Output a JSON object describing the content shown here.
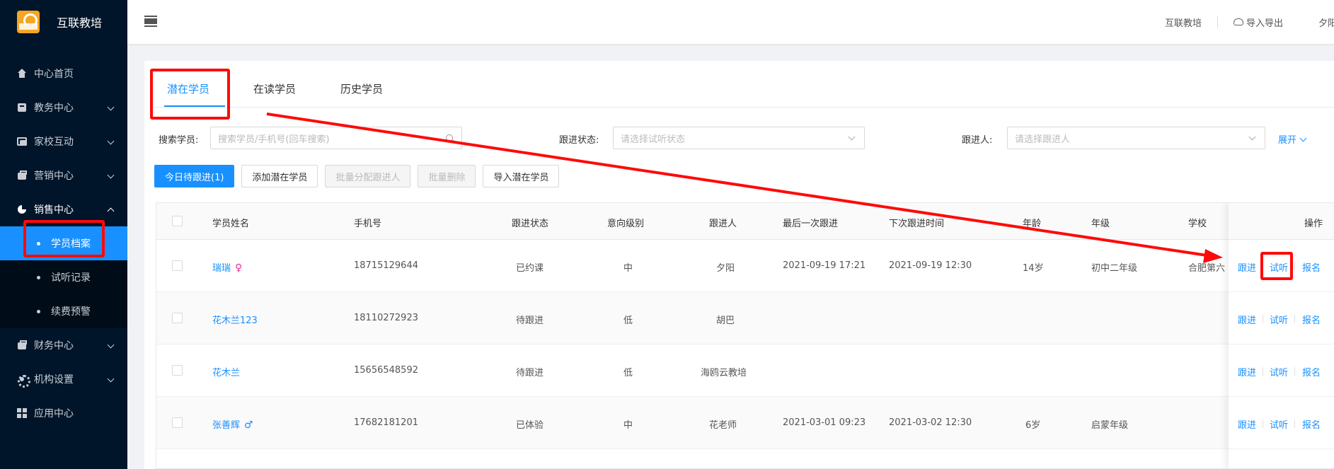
{
  "app": {
    "brand_name": "互联教培"
  },
  "sidebar": {
    "items": [
      {
        "label": "中心首页"
      },
      {
        "label": "教务中心"
      },
      {
        "label": "家校互动"
      },
      {
        "label": "营销中心"
      },
      {
        "label": "销售中心"
      },
      {
        "label": "财务中心"
      },
      {
        "label": "机构设置"
      },
      {
        "label": "应用中心"
      }
    ],
    "sales_sub": [
      {
        "label": "学员档案"
      },
      {
        "label": "试听记录"
      },
      {
        "label": "续费预警"
      }
    ]
  },
  "header": {
    "org": "互联教培",
    "import_export": "导入导出",
    "user": "夕阳"
  },
  "tabs": [
    {
      "label": "潜在学员"
    },
    {
      "label": "在读学员"
    },
    {
      "label": "历史学员"
    }
  ],
  "filters": {
    "search_label": "搜索学员:",
    "search_placeholder": "搜索学员/手机号(回车搜索)",
    "status_label": "跟进状态:",
    "status_placeholder": "请选择试听状态",
    "follower_label": "跟进人:",
    "follower_placeholder": "请选择跟进人",
    "expand_label": "展开"
  },
  "actions": {
    "today_followup": "今日待跟进(1)",
    "add_potential": "添加潜在学员",
    "batch_assign": "批量分配跟进人",
    "batch_delete": "批量删除",
    "import_potential": "导入潜在学员"
  },
  "table": {
    "columns": {
      "name": "学员姓名",
      "phone": "手机号",
      "status": "跟进状态",
      "intent": "意向级别",
      "follower": "跟进人",
      "last_follow": "最后一次跟进",
      "next_follow": "下次跟进时间",
      "age": "年龄",
      "grade": "年级",
      "school": "学校",
      "ops": "操作"
    },
    "rows": [
      {
        "name": "瑞瑞",
        "gender": "♀",
        "phone": "18715129644",
        "status": "已约课",
        "intent": "中",
        "follower": "夕阳",
        "last_follow": "2021-09-19 17:21",
        "next_follow": "2021-09-19 12:30",
        "age": "14岁",
        "grade": "初中二年级",
        "school": "合肥第六"
      },
      {
        "name": "花木兰123",
        "gender": "",
        "phone": "18110272923",
        "status": "待跟进",
        "intent": "低",
        "follower": "胡巴",
        "last_follow": "",
        "next_follow": "",
        "age": "",
        "grade": "",
        "school": ""
      },
      {
        "name": "花木兰",
        "gender": "",
        "phone": "15656548592",
        "status": "待跟进",
        "intent": "低",
        "follower": "海鸥云教培",
        "last_follow": "",
        "next_follow": "",
        "age": "",
        "grade": "",
        "school": ""
      },
      {
        "name": "张善辉",
        "gender": "♂",
        "phone": "17682181201",
        "status": "已体验",
        "intent": "中",
        "follower": "花老师",
        "last_follow": "2021-03-01 09:23",
        "next_follow": "2021-03-02 12:30",
        "age": "6岁",
        "grade": "启蒙年级",
        "school": ""
      }
    ],
    "ops": {
      "follow": "跟进",
      "trial": "试听",
      "enroll": "报名"
    }
  },
  "colors": {
    "accent": "#1890ff",
    "sidebar_bg": "#001529",
    "annotation": "#ff0a0a",
    "female": "#eb2f96",
    "male": "#1890ff"
  }
}
